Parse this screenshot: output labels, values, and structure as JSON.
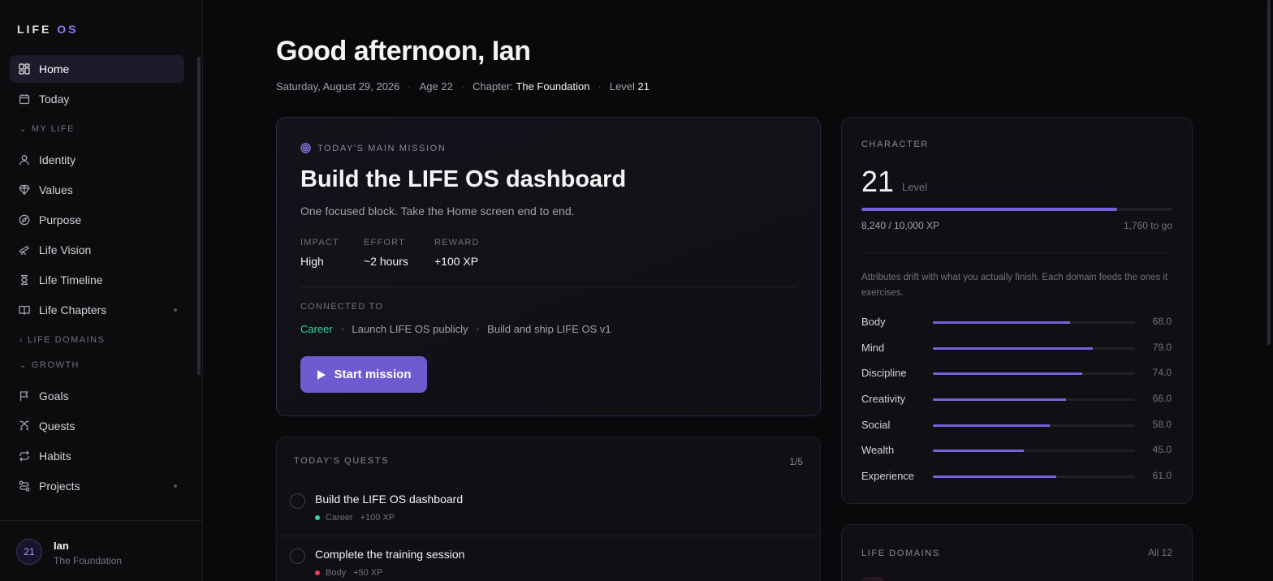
{
  "logo": {
    "life": "LIFE",
    "os": "OS"
  },
  "sidebar": {
    "home": "Home",
    "today": "Today",
    "section_my_life": "MY LIFE",
    "identity": "Identity",
    "values": "Values",
    "purpose": "Purpose",
    "life_vision": "Life Vision",
    "life_timeline": "Life Timeline",
    "life_chapters": "Life Chapters",
    "section_life_domains": "LIFE DOMAINS",
    "section_growth": "GROWTH",
    "goals": "Goals",
    "quests": "Quests",
    "habits": "Habits",
    "projects": "Projects"
  },
  "user": {
    "level": "21",
    "name": "Ian",
    "chapter": "The Foundation"
  },
  "header": {
    "greeting": "Good afternoon, Ian",
    "date": "Saturday, August 29, 2026",
    "age": "Age 22",
    "chapter_label": "Chapter:",
    "chapter_value": "The Foundation",
    "level_label": "Level",
    "level_value": "21"
  },
  "mission": {
    "label": "TODAY'S MAIN MISSION",
    "title": "Build the LIFE OS dashboard",
    "subtitle": "One focused block. Take the Home screen end to end.",
    "impact_label": "IMPACT",
    "impact_value": "High",
    "effort_label": "EFFORT",
    "effort_value": "~2 hours",
    "reward_label": "REWARD",
    "reward_value": "+100 XP",
    "connected_label": "CONNECTED TO",
    "crumb_1": "Career",
    "crumb_2": "Launch LIFE OS publicly",
    "crumb_3": "Build and ship LIFE OS v1",
    "start_label": "Start mission"
  },
  "quests": {
    "label": "TODAY'S QUESTS",
    "count": "1/5",
    "items": [
      {
        "title": "Build the LIFE OS dashboard",
        "domain": "Career",
        "xp": "+100 XP",
        "color": "#34d399"
      },
      {
        "title": "Complete the training session",
        "domain": "Body",
        "xp": "+50 XP",
        "color": "#f43f5e"
      }
    ]
  },
  "character": {
    "label": "CHARACTER",
    "level": "21",
    "level_label": "Level",
    "xp_progress": 0.824,
    "xp_text": "8,240 / 10,000 XP",
    "to_go": "1,760 to go",
    "description": "Attributes drift with what you actually finish. Each domain feeds the ones it exercises.",
    "attributes": [
      {
        "name": "Body",
        "value": "68.0",
        "level": 68
      },
      {
        "name": "Mind",
        "value": "79.0",
        "level": 79
      },
      {
        "name": "Discipline",
        "value": "74.0",
        "level": 74
      },
      {
        "name": "Creativity",
        "value": "66.0",
        "level": 66
      },
      {
        "name": "Social",
        "value": "58.0",
        "level": 58
      },
      {
        "name": "Wealth",
        "value": "45.0",
        "level": 45
      },
      {
        "name": "Experience",
        "value": "61.0",
        "level": 61
      }
    ]
  },
  "domains": {
    "label": "LIFE DOMAINS",
    "all": "All 12"
  },
  "colors": {
    "accent": "#6d5bd0",
    "bar": "#7663dc",
    "career": "#34d399",
    "body": "#f43f5e"
  }
}
